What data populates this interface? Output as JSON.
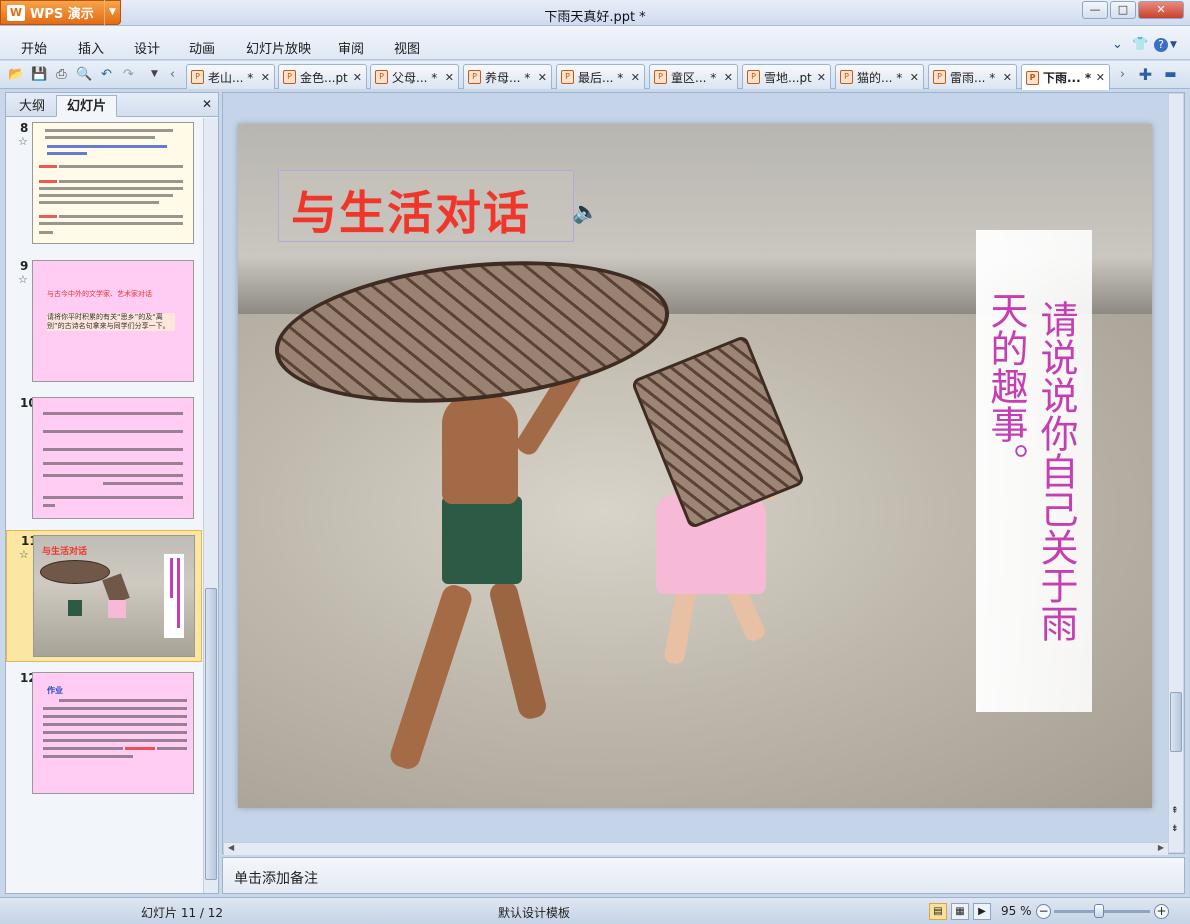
{
  "app": {
    "name": "WPS 演示",
    "logo_letter": "W"
  },
  "window": {
    "title": "下雨天真好.ppt *",
    "minimize": "—",
    "maximize": "□",
    "close": "✕"
  },
  "menu": [
    "开始",
    "插入",
    "设计",
    "动画",
    "幻灯片放映",
    "审阅",
    "视图"
  ],
  "menu_right": {
    "collapse": "⌄",
    "shirt_icon": "shirt-icon",
    "help": "?"
  },
  "tabs": [
    {
      "label": "老山... *"
    },
    {
      "label": "金色...pt"
    },
    {
      "label": "父母... *"
    },
    {
      "label": "养母... *"
    },
    {
      "label": "最后... *"
    },
    {
      "label": "童区... *"
    },
    {
      "label": "雪地...pt"
    },
    {
      "label": "猫的... *"
    },
    {
      "label": "雷雨... *"
    },
    {
      "label": "下雨... *",
      "active": true
    }
  ],
  "left_panel": {
    "tabs": [
      "大纲",
      "幻灯片"
    ],
    "active_tab": "幻灯片",
    "close": "✕",
    "slides": [
      {
        "number": "8"
      },
      {
        "number": "9",
        "title": "与古今中外的文学家、艺术家对话",
        "body": "请将你平时积累的有关“思乡”的及“离别”的古诗名句拿来与同学们分享一下。"
      },
      {
        "number": "10"
      },
      {
        "number": "11",
        "title": "与生活对话",
        "selected": true
      },
      {
        "number": "12",
        "heading": "作业"
      }
    ]
  },
  "slide": {
    "title": "与生活对话",
    "vertical_col1": "请说说你自己关于雨",
    "vertical_col2": "天的趣事。",
    "sound_icon": "speaker-icon"
  },
  "notes": {
    "placeholder": "单击添加备注"
  },
  "status": {
    "slide_counter": "幻灯片 11 / 12",
    "template": "默认设计模板",
    "zoom": "95 %",
    "zoom_value": 95
  }
}
